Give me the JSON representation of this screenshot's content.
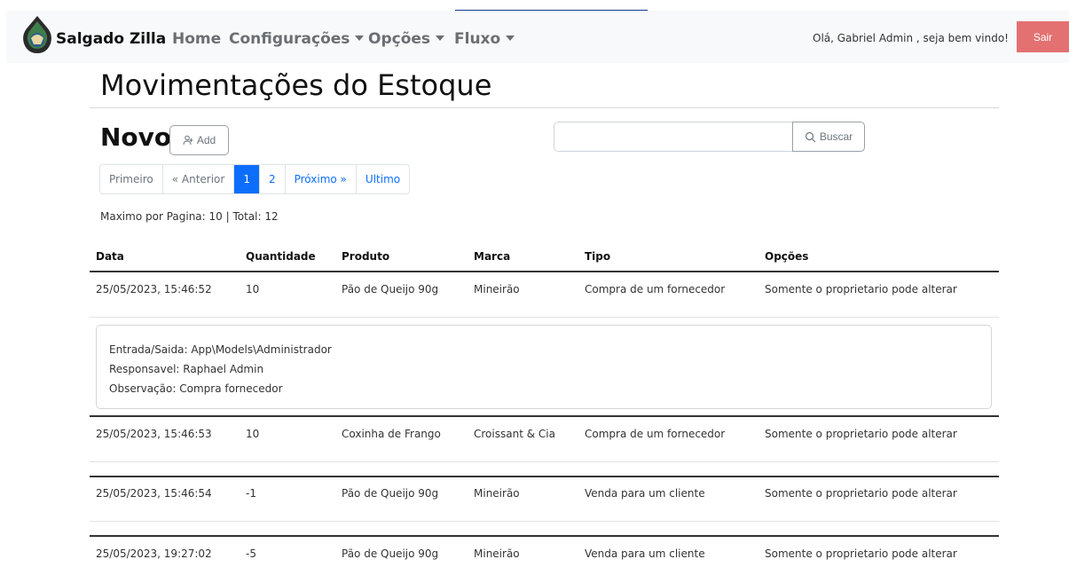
{
  "navbar": {
    "brand": "Salgado Zilla",
    "links": [
      "Home",
      "Configurações",
      "Opções",
      "Fluxo"
    ],
    "greeting": "Olá, Gabriel Admin , seja bem vindo!",
    "logout_label": "Sair",
    "logout_color": "#e37171"
  },
  "page": {
    "title": "Movimentações do Estoque",
    "new_label": "Novo",
    "add_label": "Add",
    "search_placeholder": "",
    "search_label": "Buscar",
    "summary": "Maximo por Pagina: 10 | Total: 12"
  },
  "pagination": {
    "items": [
      "Primeiro",
      "« Anterior",
      "1",
      "2",
      "Próximo »",
      "Ultimo"
    ],
    "active": "1"
  },
  "table": {
    "headers": [
      "Data",
      "Quantidade",
      "Produto",
      "Marca",
      "Tipo",
      "Opções"
    ],
    "rows": [
      [
        "25/05/2023, 15:46:52",
        "10",
        "Pão de Queijo 90g",
        "Mineirão",
        "Compra de um fornecedor",
        "Somente o proprietario pode alterar"
      ],
      [
        "25/05/2023, 15:46:53",
        "10",
        "Coxinha de Frango",
        "Croissant & Cia",
        "Compra de um fornecedor",
        "Somente o proprietario pode alterar"
      ],
      [
        "25/05/2023, 15:46:54",
        "-1",
        "Pão de Queijo 90g",
        "Mineirão",
        "Venda para um cliente",
        "Somente o proprietario pode alterar"
      ],
      [
        "25/05/2023, 19:27:02",
        "-5",
        "Pão de Queijo 90g",
        "Mineirão",
        "Venda para um cliente",
        "Somente o proprietario pode alterar"
      ]
    ],
    "detail": {
      "entrada": "Entrada/Saida: App\\Models\\Administrador",
      "responsavel": "Responsavel: Raphael Admin",
      "observacao": "Observação: Compra fornecedor"
    }
  },
  "colors": {
    "accent": "#0d6efd",
    "navbar_bg": "#f8f9fa"
  }
}
